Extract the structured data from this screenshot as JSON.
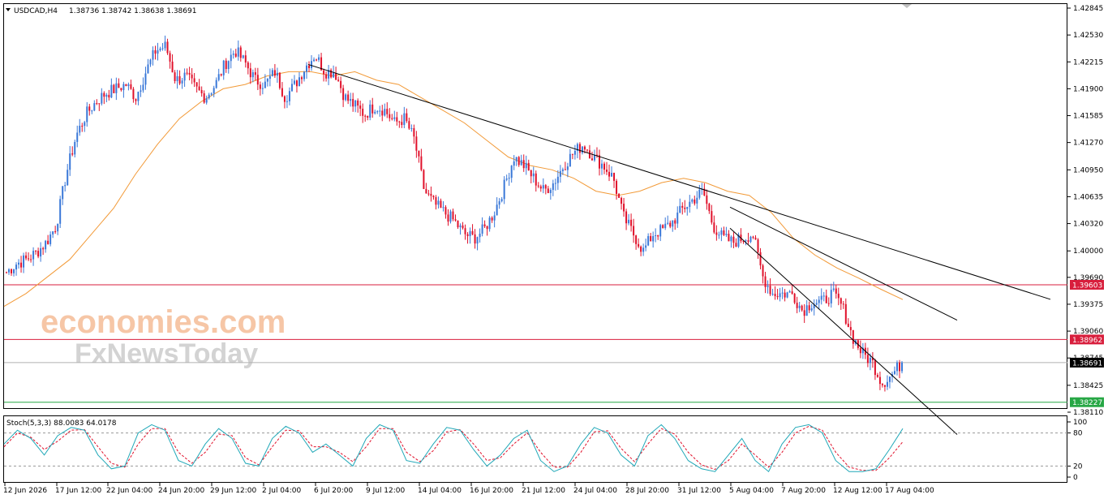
{
  "header": {
    "symbol_info": "USDCAD,H4",
    "ohlc": "1.38736 1.38742 1.38638 1.38691"
  },
  "watermark": {
    "line1": "economies.com",
    "line2": "FxNewsToday"
  },
  "stoch": {
    "label": "Stoch(5,3,3) 88.0083 64.0178",
    "levels": [
      "100",
      "80",
      "20",
      "0"
    ]
  },
  "chart_data": {
    "type": "candlestick",
    "symbol": "USDCAD",
    "timeframe": "H4",
    "ylim": [
      1.3811,
      1.42845
    ],
    "y_ticks": [
      "1.42845",
      "1.42530",
      "1.42215",
      "1.41900",
      "1.41585",
      "1.41270",
      "1.40950",
      "1.40635",
      "1.40320",
      "1.40000",
      "1.39690",
      "1.39375",
      "1.39060",
      "1.38745",
      "1.38425",
      "1.38110"
    ],
    "x_ticks": [
      "12 Jun 2026",
      "17 Jun 12:00",
      "22 Jun 04:00",
      "24 Jun 20:00",
      "29 Jun 12:00",
      "2 Jul 04:00",
      "6 Jul 20:00",
      "9 Jul 12:00",
      "14 Jul 04:00",
      "16 Jul 20:00",
      "21 Jul 12:00",
      "24 Jul 04:00",
      "28 Jul 20:00",
      "31 Jul 12:00",
      "5 Aug 04:00",
      "7 Aug 20:00",
      "12 Aug 12:00",
      "17 Aug 04:00"
    ],
    "price_path": [
      1.3975,
      1.3985,
      1.399,
      1.3998,
      1.401,
      1.403,
      1.409,
      1.4135,
      1.416,
      1.4175,
      1.4185,
      1.419,
      1.4195,
      1.418,
      1.421,
      1.4235,
      1.424,
      1.42,
      1.4205,
      1.419,
      1.418,
      1.4195,
      1.422,
      1.4235,
      1.422,
      1.42,
      1.4195,
      1.421,
      1.418,
      1.4195,
      1.4215,
      1.423,
      1.421,
      1.421,
      1.418,
      1.417,
      1.416,
      1.417,
      1.4165,
      1.415,
      1.4155,
      1.413,
      1.407,
      1.4055,
      1.4045,
      1.4035,
      1.402,
      1.4015,
      1.4025,
      1.4045,
      1.4075,
      1.411,
      1.41,
      1.4085,
      1.407,
      1.408,
      1.41,
      1.4115,
      1.4125,
      1.411,
      1.41,
      1.4085,
      1.404,
      1.402,
      1.4,
      1.402,
      1.4025,
      1.4035,
      1.405,
      1.406,
      1.407,
      1.403,
      1.4015,
      1.401,
      1.4015,
      1.402,
      1.397,
      1.395,
      1.395,
      1.395,
      1.393,
      1.394,
      1.394,
      1.395,
      1.3935,
      1.39,
      1.388,
      1.387,
      1.3845,
      1.3855,
      1.38691
    ],
    "series": [
      {
        "name": "MA",
        "values": [
          1.3935,
          1.395,
          1.397,
          1.399,
          1.402,
          1.405,
          1.409,
          1.4125,
          1.4155,
          1.4175,
          1.419,
          1.4195,
          1.4205,
          1.421,
          1.421,
          1.4205,
          1.421,
          1.42,
          1.4195,
          1.418,
          1.4165,
          1.415,
          1.413,
          1.411,
          1.41,
          1.4095,
          1.4085,
          1.407,
          1.4065,
          1.407,
          1.408,
          1.4085,
          1.408,
          1.407,
          1.4065,
          1.4045,
          1.4015,
          1.3995,
          1.398,
          1.3968,
          1.3955,
          1.3943
        ]
      }
    ],
    "trendlines": [
      {
        "from": [
          "2 Jul 04:00",
          1.4235
        ],
        "to": [
          "31 Jul 12:00",
          1.4081
        ]
      },
      {
        "from": [
          "31 Jul 12:00",
          1.4081
        ],
        "to": [
          "17 Aug 04:00",
          1.396
        ]
      },
      {
        "from": [
          "31 Jul 12:00",
          1.4081
        ],
        "to": [
          "17 Aug 04:00",
          1.386
        ]
      }
    ],
    "horizontal_levels": [
      {
        "value": 1.39603,
        "label": "1.39603",
        "color": "#d81e3c"
      },
      {
        "value": 1.38962,
        "label": "1.38962",
        "color": "#d81e3c"
      },
      {
        "value": 1.38691,
        "label": "1.38691",
        "color": "#000000"
      },
      {
        "value": 1.38227,
        "label": "1.38227",
        "color": "#27a745"
      }
    ],
    "colors": {
      "up": "#3a78d8",
      "down": "#e0102a",
      "ma": "#f29a38",
      "trend": "#000000"
    },
    "stochastic": {
      "k": [
        60,
        85,
        70,
        40,
        75,
        90,
        85,
        40,
        15,
        20,
        80,
        95,
        85,
        30,
        20,
        60,
        88,
        70,
        25,
        20,
        70,
        92,
        80,
        45,
        60,
        40,
        20,
        70,
        95,
        85,
        30,
        25,
        60,
        90,
        85,
        50,
        20,
        40,
        70,
        85,
        30,
        10,
        20,
        60,
        90,
        80,
        40,
        20,
        75,
        95,
        70,
        30,
        15,
        10,
        40,
        70,
        30,
        10,
        60,
        90,
        95,
        80,
        30,
        10,
        10,
        15,
        50,
        88
      ],
      "d": [
        55,
        80,
        72,
        50,
        65,
        85,
        86,
        55,
        25,
        18,
        60,
        88,
        88,
        45,
        25,
        45,
        78,
        75,
        35,
        22,
        55,
        85,
        84,
        55,
        55,
        45,
        28,
        55,
        88,
        88,
        45,
        28,
        48,
        82,
        86,
        60,
        30,
        35,
        60,
        80,
        45,
        18,
        18,
        45,
        82,
        84,
        52,
        28,
        60,
        88,
        78,
        45,
        22,
        14,
        30,
        60,
        40,
        18,
        45,
        80,
        92,
        85,
        45,
        18,
        12,
        12,
        35,
        64
      ]
    }
  }
}
